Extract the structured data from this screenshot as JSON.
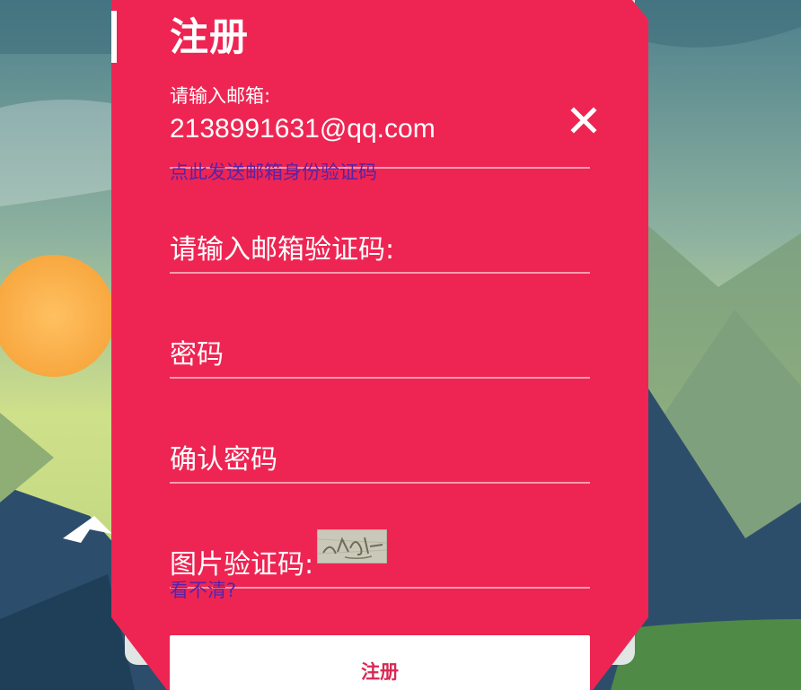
{
  "form": {
    "title": "注册",
    "email_label": "请输入邮箱:",
    "email_value": "2138991631@qq.com",
    "send_code_link": "点此发送邮箱身份验证码",
    "email_code_placeholder": "请输入邮箱验证码:",
    "password_placeholder": "密码",
    "confirm_password_placeholder": "确认密码",
    "captcha_label": "图片验证码:",
    "captcha_refresh_link": "看不清?",
    "submit_label": "注册"
  },
  "colors": {
    "card": "#ee2553",
    "link": "#5a22a6",
    "submit_text": "#d82853",
    "background_sky": "#6f9a9c"
  },
  "icons": {
    "close": "close-icon",
    "captcha": "captcha-image"
  }
}
